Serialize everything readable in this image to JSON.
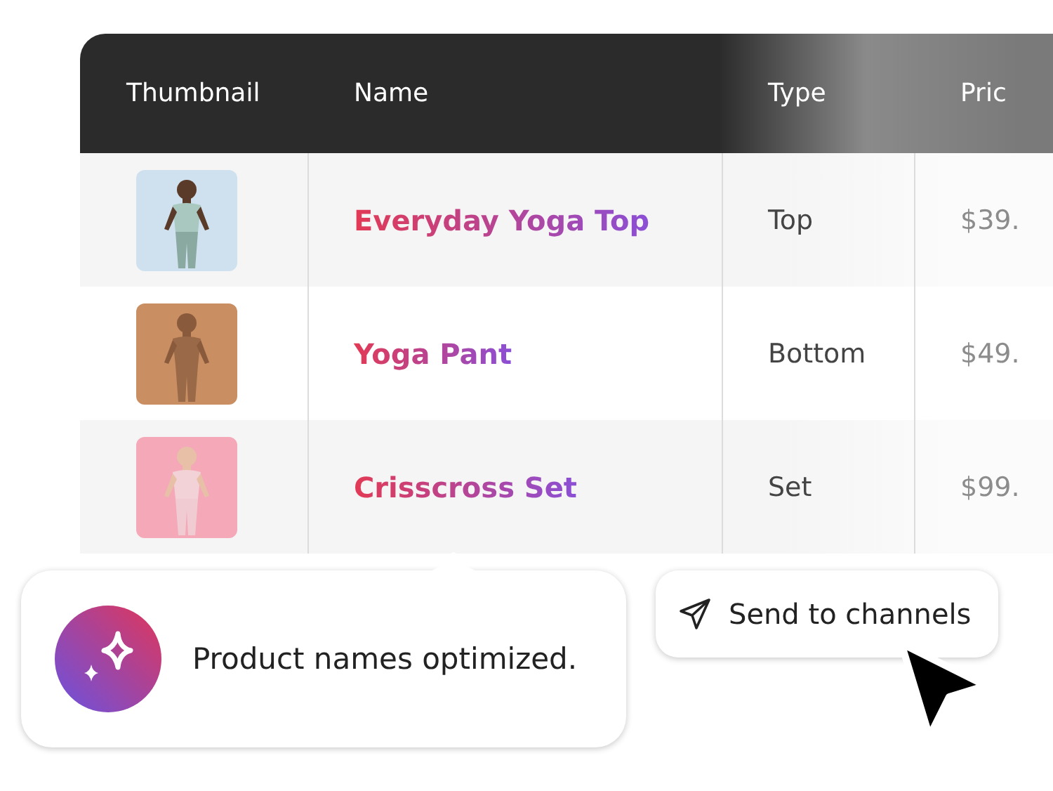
{
  "table": {
    "columns": [
      "Thumbnail",
      "Name",
      "Type",
      "Pric"
    ],
    "rows": [
      {
        "name": "Everyday Yoga Top",
        "type": "Top",
        "price": "$39."
      },
      {
        "name": "Yoga Pant",
        "type": "Bottom",
        "price": "$49."
      },
      {
        "name": "Crisscross Set",
        "type": "Set",
        "price": "$99."
      }
    ]
  },
  "toast": {
    "message": "Product names optimized."
  },
  "action_button": {
    "label": "Send to channels"
  }
}
